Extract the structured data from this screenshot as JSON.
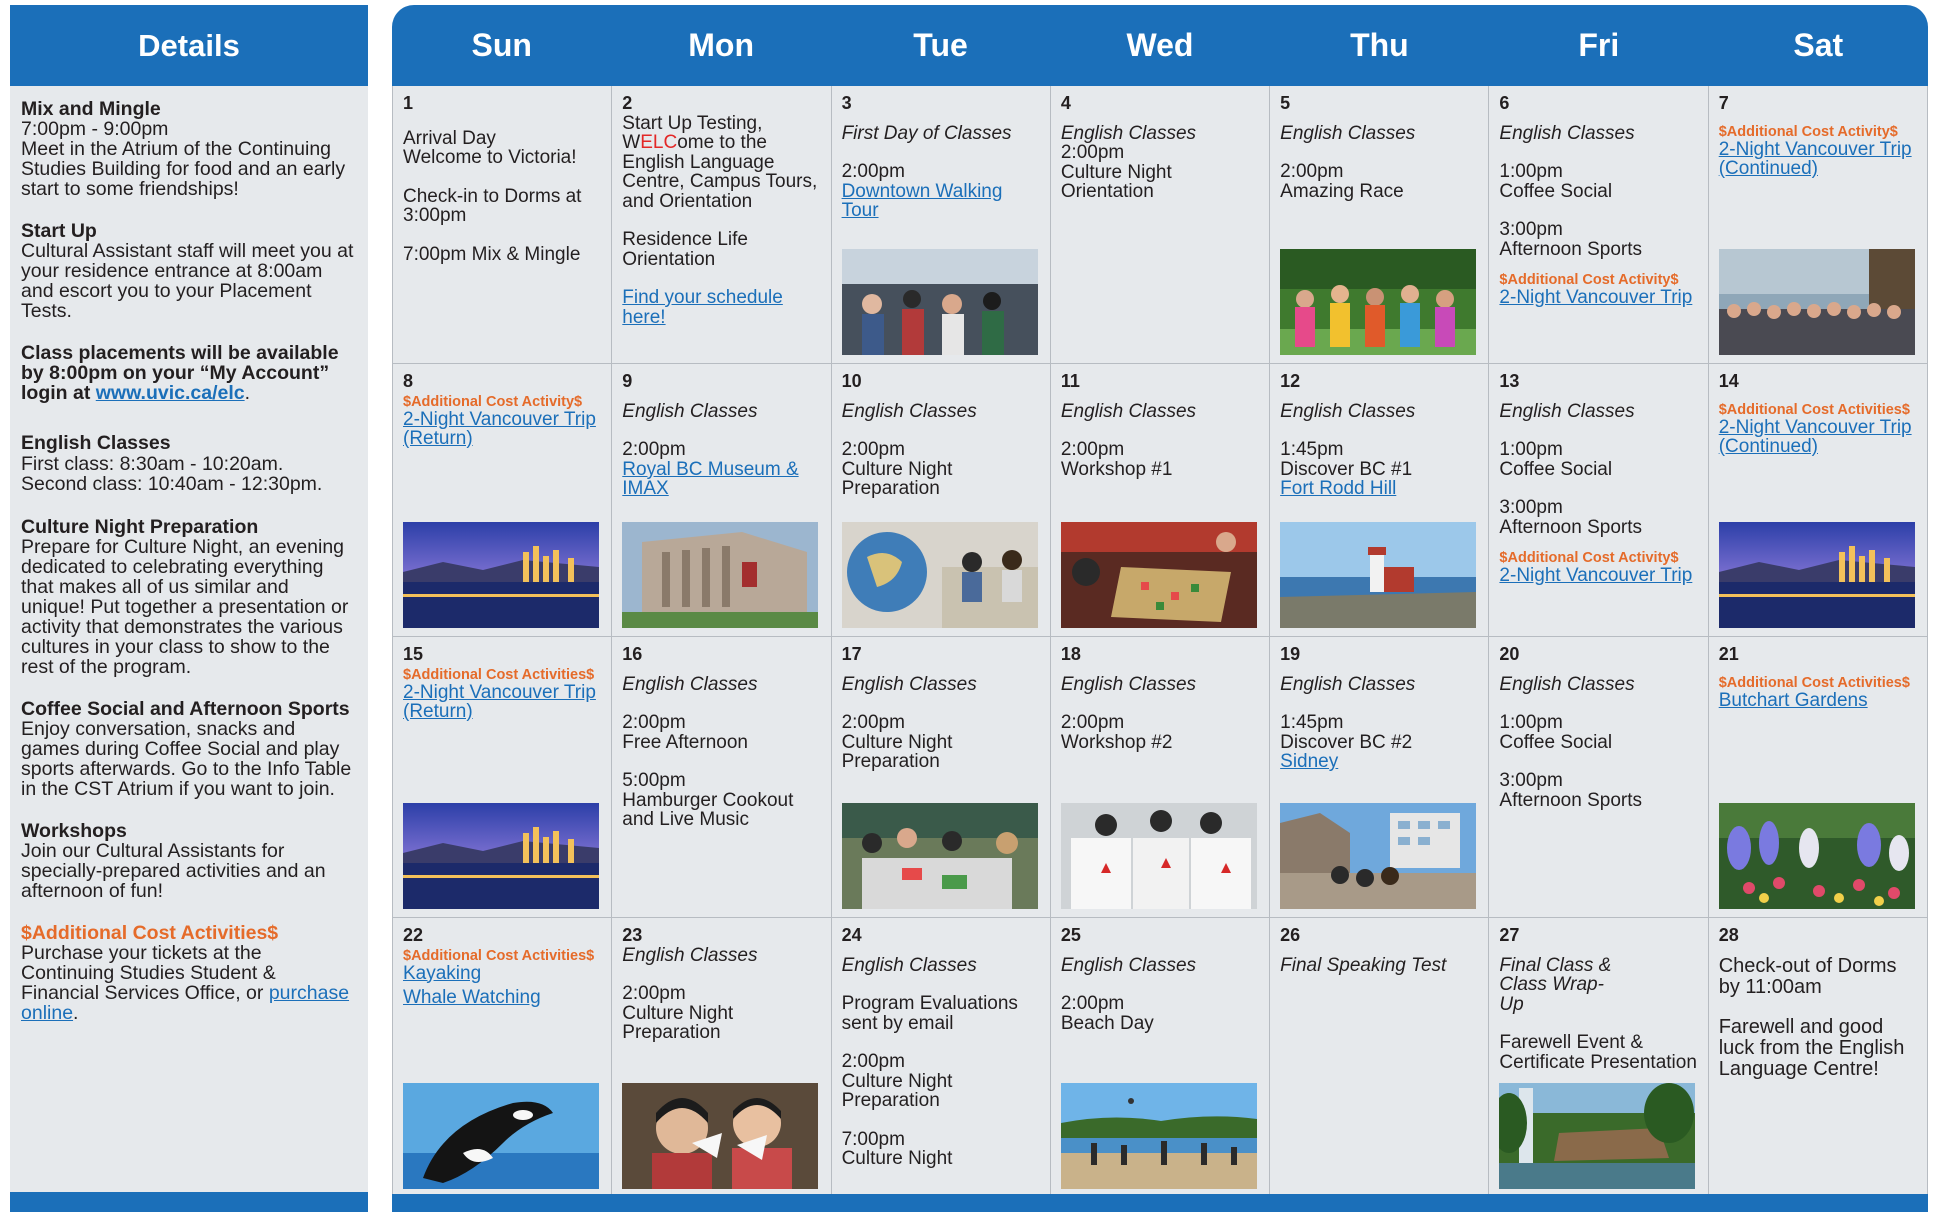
{
  "details": {
    "header": "Details",
    "sections": [
      {
        "title": "Mix and Mingle",
        "text": "7:00pm - 9:00pm\nMeet in the Atrium of the Continuing Studies Building for food and an early start to some friendships!"
      },
      {
        "title": "Start Up",
        "text": "Cultural Assistant staff will meet you at your residence entrance at 8:00am and escort you to your Placement Tests."
      },
      {
        "title": "Class placements will be available by 8:00pm on your “My Account” login at",
        "link": "www.uvic.ca/elc",
        "after": "."
      },
      {
        "title": "English Classes",
        "text": "First class: 8:30am - 10:20am.\nSecond class: 10:40am - 12:30pm."
      },
      {
        "title": "Culture Night Preparation",
        "text": "Prepare for Culture Night, an evening dedicated to celebrating everything that makes all of us similar and unique! Put together a presentation or activity that demonstrates the various cultures in your class to show to the rest of the program."
      },
      {
        "title": "Coffee Social and Afternoon Sports",
        "text": "Enjoy conversation, snacks and games during Coffee Social and play sports afterwards. Go to the Info Table in the CST Atrium if you want to join."
      },
      {
        "title": "Workshops",
        "text": "Join our Cultural Assistants for specially-prepared activities and an afternoon of fun!"
      },
      {
        "title": "$Additional Cost Activities$",
        "text": "Purchase your tickets at the Continuing Studies Student & Financial Services Office, or",
        "link": "purchase online",
        "after": "."
      }
    ]
  },
  "calendar": {
    "days_of_week": [
      "Sun",
      "Mon",
      "Tue",
      "Wed",
      "Thu",
      "Fri",
      "Sat"
    ],
    "extra_label": "$Additional Cost Activity$",
    "extra_label_plural": "$Additional Cost Activities$",
    "cells": {
      "d1": {
        "num": "1",
        "arrival": "Arrival Day",
        "welcome": "Welcome to Victoria!",
        "checkin": "Check-in to Dorms at 3:00pm",
        "mix": "7:00pm Mix & Mingle"
      },
      "d2": {
        "num": "2",
        "a": "Start Up Testing,",
        "b1": "W",
        "b2": "ELC",
        "b3": "ome to the English Language Centre, Campus Tours, and Orientation",
        "res": "Residence Life Orientation",
        "link": "Find your schedule here!"
      },
      "d3": {
        "num": "3",
        "first": "First Day of Classes",
        "time": "2:00pm",
        "link": "Downtown Walking Tour"
      },
      "d4": {
        "num": "4",
        "classes": "English Classes",
        "time": "2:00pm",
        "event": "Culture Night Orientation"
      },
      "d5": {
        "num": "5",
        "classes": "English Classes",
        "time": "2:00pm",
        "event": "Amazing Race"
      },
      "d6": {
        "num": "6",
        "classes": "English Classes",
        "t1": "1:00pm",
        "e1": "Coffee Social",
        "t2": "3:00pm",
        "e2": "Afternoon Sports",
        "link": "2-Night Vancouver Trip"
      },
      "d7": {
        "num": "7",
        "link": "2-Night Vancouver Trip (Continued)"
      },
      "d8": {
        "num": "8",
        "link": "2-Night Vancouver Trip (Return)"
      },
      "d9": {
        "num": "9",
        "classes": "English Classes",
        "time": "2:00pm",
        "link": "Royal BC Museum & IMAX"
      },
      "d10": {
        "num": "10",
        "classes": "English Classes",
        "time": "2:00pm",
        "event": "Culture Night Preparation"
      },
      "d11": {
        "num": "11",
        "classes": "English Classes",
        "time": "2:00pm",
        "event": "Workshop #1"
      },
      "d12": {
        "num": "12",
        "classes": "English Classes",
        "time": "1:45pm",
        "event": "Discover BC #1",
        "link": "Fort Rodd Hill"
      },
      "d13": {
        "num": "13",
        "classes": "English Classes",
        "t1": "1:00pm",
        "e1": "Coffee Social",
        "t2": "3:00pm",
        "e2": "Afternoon Sports",
        "link": "2-Night Vancouver Trip"
      },
      "d14": {
        "num": "14",
        "link": "2-Night Vancouver Trip (Continued)"
      },
      "d15": {
        "num": "15",
        "link": "2-Night Vancouver Trip (Return)"
      },
      "d16": {
        "num": "16",
        "classes": "English Classes",
        "t1": "2:00pm",
        "e1": "Free Afternoon",
        "t2": "5:00pm",
        "e2": "Hamburger Cookout and Live Music"
      },
      "d17": {
        "num": "17",
        "classes": "English Classes",
        "time": "2:00pm",
        "event": "Culture Night Preparation"
      },
      "d18": {
        "num": "18",
        "classes": "English Classes",
        "time": "2:00pm",
        "event": "Workshop #2"
      },
      "d19": {
        "num": "19",
        "classes": "English Classes",
        "time": "1:45pm",
        "event": "Discover BC #2",
        "link": "Sidney"
      },
      "d20": {
        "num": "20",
        "classes": "English Classes",
        "t1": "1:00pm",
        "e1": "Coffee Social",
        "t2": "3:00pm",
        "e2": "Afternoon Sports"
      },
      "d21": {
        "num": "21",
        "link": "Butchart Gardens"
      },
      "d22": {
        "num": "22",
        "link1": "Kayaking",
        "link2": "Whale Watching"
      },
      "d23": {
        "num": "23",
        "classes": "English Classes",
        "time": "2:00pm",
        "event": "Culture Night Preparation"
      },
      "d24": {
        "num": "24",
        "classes": "English Classes",
        "eval": "Program Evaluations sent by email",
        "t1": "2:00pm",
        "e1": "Culture Night Preparation",
        "t2": "7:00pm",
        "e2": "Culture Night"
      },
      "d25": {
        "num": "25",
        "classes": "English Classes",
        "time": "2:00pm",
        "event": "Beach Day"
      },
      "d26": {
        "num": "26",
        "test": "Final Speaking Test"
      },
      "d27": {
        "num": "27",
        "final": "Final Class & Class Wrap-Up",
        "event": "Farewell Event & Certificate Presentation"
      },
      "d28": {
        "num": "28",
        "checkout": "Check-out of Dorms by 11:00am",
        "farewell": "Farewell and good luck from the English Language Centre!"
      }
    }
  },
  "colors": {
    "brand_blue": "#1b6fb9",
    "extra_orange": "#e56b2a",
    "cell_bg": "#e6e9ec",
    "elc_red": "#e32726"
  }
}
